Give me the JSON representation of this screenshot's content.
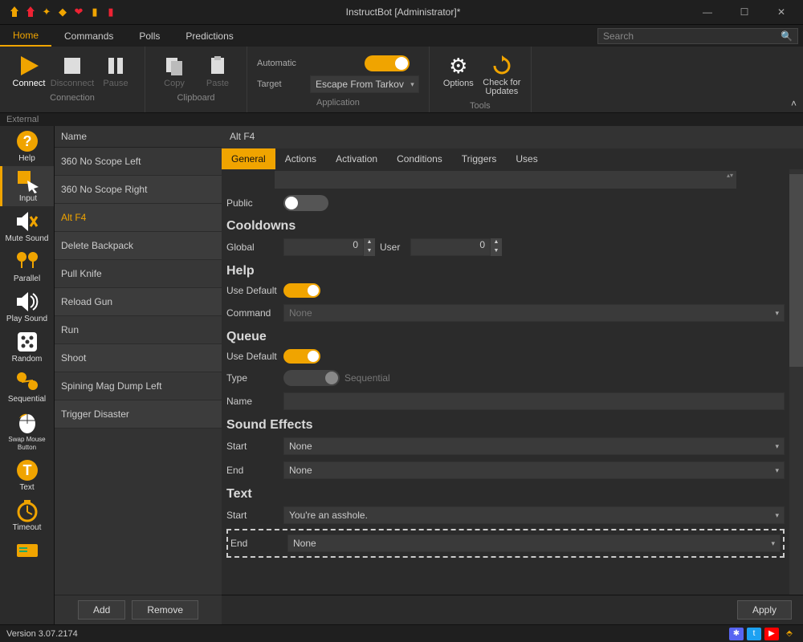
{
  "window": {
    "title": "InstructBot [Administrator]*"
  },
  "menu": {
    "items": [
      "Home",
      "Commands",
      "Polls",
      "Predictions"
    ],
    "active": 0,
    "search_placeholder": "Search"
  },
  "ribbon": {
    "connection": {
      "label": "Connection",
      "connect": "Connect",
      "disconnect": "Disconnect",
      "pause": "Pause"
    },
    "clipboard": {
      "label": "Clipboard",
      "copy": "Copy",
      "paste": "Paste"
    },
    "application": {
      "label": "Application",
      "automatic_lbl": "Automatic",
      "automatic_on": true,
      "target_lbl": "Target",
      "target_value": "Escape From Tarkov"
    },
    "tools": {
      "label": "Tools",
      "options": "Options",
      "updates": "Check for Updates"
    }
  },
  "external_strip": "External",
  "vtb": [
    {
      "label": "Help",
      "icon": "help"
    },
    {
      "label": "Input",
      "icon": "input",
      "active": true
    },
    {
      "label": "Mute Sound",
      "icon": "mute"
    },
    {
      "label": "Parallel",
      "icon": "parallel"
    },
    {
      "label": "Play Sound",
      "icon": "play"
    },
    {
      "label": "Random",
      "icon": "dice"
    },
    {
      "label": "Sequential",
      "icon": "seq"
    },
    {
      "label": "Swap Mouse Button",
      "icon": "swap"
    },
    {
      "label": "Text",
      "icon": "text"
    },
    {
      "label": "Timeout",
      "icon": "timeout"
    },
    {
      "label": "",
      "icon": "card"
    }
  ],
  "items_header": "Name",
  "items": [
    "360 No Scope Left",
    "360 No Scope Right",
    "Alt F4",
    "Delete Backpack",
    "Pull Knife",
    "Reload Gun",
    "Run",
    "Shoot",
    "Spining Mag Dump Left",
    "Trigger Disaster"
  ],
  "selected_item_index": 2,
  "item_buttons": {
    "add": "Add",
    "remove": "Remove"
  },
  "detail": {
    "title": "Alt F4",
    "tabs": [
      "General",
      "Actions",
      "Activation",
      "Conditions",
      "Triggers",
      "Uses"
    ],
    "active_tab": 0,
    "public_lbl": "Public",
    "public_on": false,
    "cooldowns_hdr": "Cooldowns",
    "global_lbl": "Global",
    "global_val": "0",
    "user_lbl": "User",
    "user_val": "0",
    "help_hdr": "Help",
    "usedefault1_lbl": "Use Default",
    "usedefault1_on": true,
    "command_lbl": "Command",
    "command_val": "None",
    "queue_hdr": "Queue",
    "usedefault2_lbl": "Use Default",
    "usedefault2_on": true,
    "type_lbl": "Type",
    "type_val": "Sequential",
    "name_lbl": "Name",
    "name_val": "",
    "sfx_hdr": "Sound Effects",
    "sfx_start_lbl": "Start",
    "sfx_start_val": "None",
    "sfx_end_lbl": "End",
    "sfx_end_val": "None",
    "text_hdr": "Text",
    "text_start_lbl": "Start",
    "text_start_val": "You're an asshole.",
    "text_end_lbl": "End",
    "text_end_val": "None",
    "apply": "Apply"
  },
  "status": {
    "version": "Version 3.07.2174"
  }
}
